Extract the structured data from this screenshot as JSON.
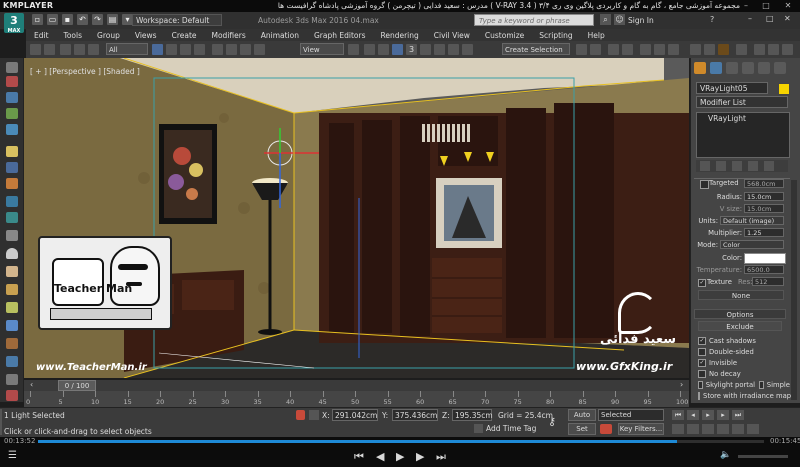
{
  "kmplayer": {
    "app_name": "KMPLAYER",
    "title": "مجموعه آموزشی جامع ، گام به گام و کاربردی پلاگین وی ری ۳/۴ ( V-RAY 3.4 )  مدرس : سعید فدایی ( تیچرمن ) گروه آموزشی پادشاه گرافیست ها",
    "minimize": "–",
    "maximize": "□",
    "close": "✕"
  },
  "max_titlebar": {
    "logo": "3",
    "logo_sub": "MAX",
    "workspace": "Workspace: Default",
    "title": "Autodesk 3ds Max 2016   04.max",
    "search_placeholder": "Type a keyword or phrase",
    "sign_in": "Sign In"
  },
  "menu": [
    "Edit",
    "Tools",
    "Group",
    "Views",
    "Create",
    "Modifiers",
    "Animation",
    "Graph Editors",
    "Rendering",
    "Civil View",
    "Customize",
    "Scripting",
    "Help"
  ],
  "toolbar": {
    "filter_dropdown": "All",
    "view_dropdown": "View",
    "selection_set": "Create Selection Se"
  },
  "viewport": {
    "label": "[ + ] [Perspective ] [Shaded ]"
  },
  "watermarks": {
    "teacher_caption": "Teacher Man",
    "teacher_url": "www.TeacherMan.ir",
    "gfx_name": "سعید فدائی",
    "gfx_url": "www.GfxKing.ir"
  },
  "command_panel": {
    "object_name": "VRayLight05",
    "object_color": "#f6d400",
    "modifier_list": "Modifier List",
    "stack_item": "VRayLight",
    "params": {
      "targeted_label": "Targeted",
      "targeted_value": "568.0cm",
      "radius_label": "Radius:",
      "radius_value": "15.0cm",
      "vsize_label": "V size:",
      "vsize_value": "15.0cm",
      "units_label": "Units:",
      "units_value": "Default (image)",
      "multiplier_label": "Multiplier:",
      "multiplier_value": "1.25",
      "mode_label": "Mode:",
      "mode_value": "Color",
      "color_label": "Color:",
      "color_swatch": "#ffffff",
      "temperature_label": "Temperature:",
      "temperature_value": "6500.0",
      "texture_label": "Texture",
      "res_label": "Res:",
      "res_value": "512",
      "none_label": "None"
    },
    "options_title": "Options",
    "exclude_button": "Exclude",
    "options": [
      {
        "label": "Cast shadows",
        "checked": true
      },
      {
        "label": "Double-sided",
        "checked": false
      },
      {
        "label": "Invisible",
        "checked": true
      },
      {
        "label": "No decay",
        "checked": false
      },
      {
        "label": "Skylight portal",
        "checked": false
      },
      {
        "label": "Store with irradiance map",
        "checked": false
      }
    ],
    "simple_label": "Simple"
  },
  "timeline": {
    "frame_counter": "0 / 100",
    "ticks": [
      "0",
      "5",
      "10",
      "15",
      "20",
      "25",
      "30",
      "35",
      "40",
      "45",
      "50",
      "55",
      "60",
      "65",
      "70",
      "75",
      "80",
      "85",
      "90",
      "95",
      "100"
    ]
  },
  "status": {
    "selected_count": "1 Light Selected",
    "prompt": "Click or click-and-drag to select objects",
    "x_label": "X:",
    "x_value": "291.042cm",
    "y_label": "Y:",
    "y_value": "375.436cm",
    "z_label": "Z:",
    "z_value": "195.35cm",
    "grid": "Grid = 25.4cm",
    "add_time_tag": "Add Time Tag",
    "auto_key": "Auto Key",
    "key_mode": "Selected",
    "set_key": "Set Key",
    "key_filters": "Key Filters..."
  },
  "player": {
    "current_time": "00:13:52",
    "total_time": "00:15:45",
    "progress": 0.88
  }
}
